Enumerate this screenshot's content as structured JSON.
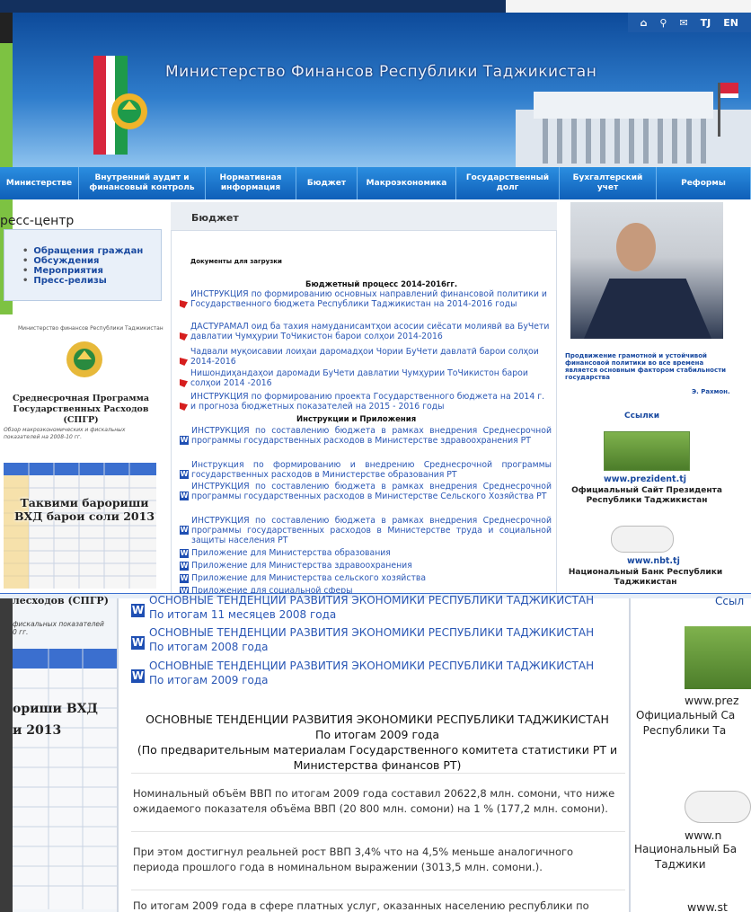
{
  "header": {
    "title": "Министерство Финансов Республики Таджикистан",
    "icons": [
      "home-icon",
      "search-icon",
      "mail-icon"
    ],
    "lang": [
      "TJ",
      "EN"
    ]
  },
  "nav": [
    {
      "label": "Министерстве",
      "w": 88
    },
    {
      "label": "Внутренний аудит и финансовый контроль",
      "w": 141
    },
    {
      "label": "Нормативная информация",
      "w": 101
    },
    {
      "label": "Бюджет",
      "w": 68
    },
    {
      "label": "Макроэкономика",
      "w": 110
    },
    {
      "label": "Государственный долг",
      "w": 115
    },
    {
      "label": "Бухгалтерский учет",
      "w": 108
    },
    {
      "label": "Реформы",
      "w": 105
    }
  ],
  "left": {
    "press_title": "ресс-центр",
    "press_items": [
      "Обращения граждан",
      "Обсуждения",
      "Мероприятия",
      "Пресс-релизы"
    ],
    "doc_header": "Министерство финансов Республики Таджикистан",
    "doc_title": "Среднесрочная Программа Государственных Расходов (СПГР)",
    "doc_sub": "Обзор макроэкономических и фискальных показателей на 2008-10 гг.",
    "doc_overlay": "Таквими барориши ВХД барои соли 2013"
  },
  "main": {
    "section_title": "Бюджет",
    "downloads_title": "Документы для загрузки",
    "budget_title": "Бюджетный процесс 2014-2016гг.",
    "pdf_docs": [
      "ИНСТРУКЦИЯ по формированию основных направлений финансовой политики и Государственного бюджета Республики Таджикистан на 2014-2016 годы",
      "ДАСТУРАМАЛ оид ба тахия намуданисамтҳои асосии сиёсати молиявӣ ва БуЧети давлатии Чумҳурии ТоЧикистон барои солҳои 2014-2016",
      "Чадвали муқоисавии лоиҳаи даромадҳои Чории БуЧети давлатӣ барои солҳои 2014-2016",
      "Нишондиҳандаҳои даромади БуЧети давлатии Чумҳурии ТоЧикистон барои солҳои 2014 -2016",
      "ИНСТРУКЦИЯ по формированию проекта Государственного бюджета на 2014 г. и прогноза бюджетных показателей на 2015 - 2016 годы"
    ],
    "instr_title": "Инструкции и Приложения",
    "word_docs": [
      "ИНСТРУКЦИЯ по составлению бюджета в рамках внедрения Среднесрочной программы государственных расходов в Министерстве здравоохранения РТ",
      "Инструкция по формированию и внедрению Среднесрочной программы государственных расходов в Министерстве образования РТ",
      "ИНСТРУКЦИЯ по составлению бюджета в рамках внедрения Среднесрочной программы государственных расходов в Министерстве Сельского Хозяйства РТ",
      "ИНСТРУКЦИЯ по составлению бюджета в рамках внедрения Среднесрочной программы государственных расходов в Министерстве труда и социальной защиты населения РТ",
      "Приложение для Министерства образования",
      "Приложение для Министерства здравоохранения",
      "Приложение для Министерства сельского хозяйства",
      "Приложение для социальной сферы"
    ]
  },
  "right": {
    "quote": "Продвижение грамотной и устойчивой финансовой политики во все времена является основным фактором стабильности государства",
    "quote_author": "Э. Рахмон.",
    "links_title": "Ссылки",
    "pres_url": "www.prezident.tj",
    "pres_caption": "Официальный Сайт Президента Республики Таджикистан",
    "nbt_url": "www.nbt.tj",
    "nbt_caption": "Национальный Банк Республики Таджикистан"
  },
  "lower": {
    "left_title": "лесходов (СПГР)",
    "left_sub": "фискальных показателей\n0 гг.",
    "left_overlay": "ориши ВХД\nи 2013",
    "docs": [
      "ОСНОВНЫЕ ТЕНДЕНЦИИ РАЗВИТИЯ ЭКОНОМИКИ РЕСПУБЛИКИ ТАДЖИКИСТАН По итогам 11 месяцев 2008 года",
      "ОСНОВНЫЕ ТЕНДЕНЦИИ РАЗВИТИЯ ЭКОНОМИКИ РЕСПУБЛИКИ ТАДЖИКИСТАН По итогам 2008 года",
      "ОСНОВНЫЕ ТЕНДЕНЦИИ РАЗВИТИЯ ЭКОНОМИКИ  РЕСПУБЛИКИ ТАДЖИКИСТАН По итогам 2009 года"
    ],
    "report_title": "ОСНОВНЫЕ ТЕНДЕНЦИИ РАЗВИТИЯ ЭКОНОМИКИ РЕСПУБЛИКИ ТАДЖИКИСТАН\nПо итогам 2009 года\n(По предварительным материалам Государственного комитета статистики РТ и\nМинистерства финансов РТ)",
    "paragraphs": [
      "Номинальный объём ВВП по итогам 2009 года составил 20622,8 млн. сомони, что ниже ожидаемого показателя объёма ВВП (20 800 млн. сомони) на 1 % (177,2 млн. сомони).",
      "При этом достигнул реальней рост ВВП 3,4% что на 4,5% меньше аналогичного периода прошлого года в номинальном выражении (3013,5 млн. сомони.).",
      "По итогам 2009 года в сфере платных услуг, оказанных населению республики по"
    ],
    "right_links": "Ссыл",
    "right_url": "www.prez",
    "right_caption": "Официальный Са\n  Республики Та",
    "right_nbt_url": "www.n",
    "right_nbt_caption": "Национальный Ба\n      Таджики",
    "right_st": "www.st"
  }
}
